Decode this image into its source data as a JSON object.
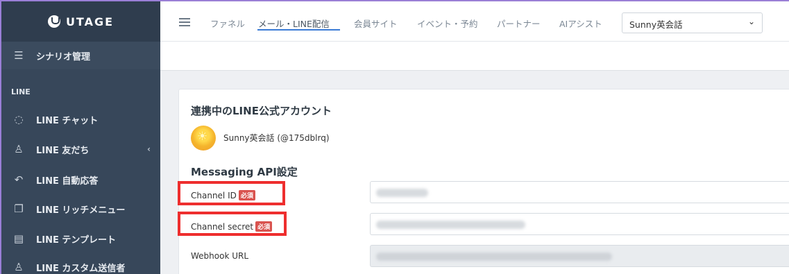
{
  "brand": {
    "name": "UTAGE"
  },
  "sidebar": {
    "section_label": "LINE",
    "items": [
      {
        "label": "シナリオ管理",
        "icon": "list-icon"
      },
      {
        "label": "LINE チャット",
        "icon": "chat-icon"
      },
      {
        "label": "LINE 友だち",
        "icon": "user-icon"
      },
      {
        "label": "LINE 自動応答",
        "icon": "reply-icon"
      },
      {
        "label": "LINE リッチメニュー",
        "icon": "copy-icon"
      },
      {
        "label": "LINE テンプレート",
        "icon": "document-icon"
      },
      {
        "label": "LINE カスタム送信者",
        "icon": "users-icon"
      }
    ],
    "chevron": "‹"
  },
  "topnav": {
    "tabs": [
      "ファネル",
      "メール・LINE配信",
      "会員サイト",
      "イベント・予約",
      "パートナー",
      "AIアシスト"
    ],
    "active_tab": "メール・LINE配信",
    "account_select": "Sunny英会話"
  },
  "card": {
    "title": "連携中のLINE公式アカウント",
    "account_name": "Sunny英会話 (@175dblrq)",
    "section_title": "Messaging API設定",
    "required_badge": "必須",
    "fields": [
      {
        "label": "Channel ID",
        "required": true,
        "value_obscured": true
      },
      {
        "label": "Channel secret",
        "required": true,
        "value_obscured": true
      },
      {
        "label": "Webhook URL",
        "required": false,
        "value_obscured": true,
        "readonly": true
      }
    ]
  },
  "colors": {
    "sidebar_bg": "#37475a",
    "accent": "#3a7bd5",
    "required": "#d9534f",
    "highlight": "#ee2e2e"
  }
}
